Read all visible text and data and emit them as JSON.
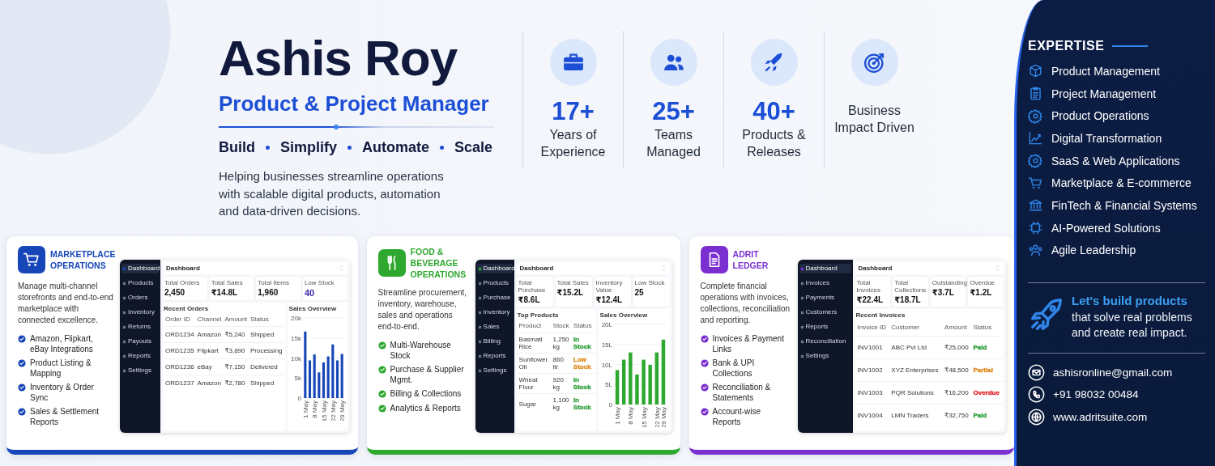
{
  "profile": {
    "name": "Ashis Roy",
    "role": "Product & Project Manager",
    "pillars": [
      "Build",
      "Simplify",
      "Automate",
      "Scale"
    ],
    "summary": "Helping businesses streamline operations with scalable digital products, automation and data-driven decisions."
  },
  "highlights": [
    {
      "value": "17+",
      "label": "Years of Experience"
    },
    {
      "value": "25+",
      "label": "Teams Managed"
    },
    {
      "value": "40+",
      "label": "Products & Releases"
    },
    {
      "label": "Business Impact Driven"
    }
  ],
  "cards": [
    {
      "title": "MARKETPLACE OPERATIONS",
      "color": "#1746b8",
      "description": "Manage multi-channel storefronts and end-to-end marketplace with connected excellence.",
      "features": [
        "Amazon, Flipkart, eBay Integrations",
        "Product Listing & Mapping",
        "Inventory & Order Sync",
        "Sales & Settlement Reports"
      ],
      "dashboard": {
        "nav": [
          {
            "label": "Dashboard",
            "selected": true
          },
          {
            "label": "Products",
            "selected": false
          },
          {
            "label": "Orders",
            "selected": false
          },
          {
            "label": "Inventory",
            "selected": false
          },
          {
            "label": "Returns",
            "selected": false
          },
          {
            "label": "Payouts",
            "selected": false
          },
          {
            "label": "Reports",
            "selected": false
          },
          {
            "label": "Settings",
            "selected": false
          }
        ],
        "heading": "Dashboard",
        "stats": [
          {
            "label": "Total Orders",
            "value": "2,450",
            "highlighted": false
          },
          {
            "label": "Total Sales",
            "value": "₹14.8L",
            "highlighted": false
          },
          {
            "label": "Total Items",
            "value": "1,960",
            "highlighted": false
          },
          {
            "label": "Low Stock",
            "value": "40",
            "highlighted": true
          }
        ],
        "table": {
          "title": "Recent Orders",
          "columns": [
            "Order ID",
            "Channel",
            "Amount",
            "Status"
          ],
          "rows": [
            {
              "cells": [
                "ORD1234",
                "Amazon",
                "₹5,240",
                "Shipped"
              ]
            },
            {
              "cells": [
                "ORD1235",
                "Flipkart",
                "₹3,890",
                "Processing"
              ]
            },
            {
              "cells": [
                "ORD1236",
                "eBay",
                "₹7,150",
                "Delivered"
              ]
            },
            {
              "cells": [
                "ORD1237",
                "Amazon",
                "₹2,780",
                "Shipped"
              ]
            }
          ]
        },
        "chart": {
          "title": "Sales Overview",
          "chart_data": {
            "type": "bar",
            "categories": [
              "1 May",
              null,
              "8 May",
              null,
              "15 May",
              null,
              "22 May",
              null,
              "29 May"
            ],
            "values": [
              16.6,
              9.4,
              10.9,
              6.4,
              8.9,
              10.4,
              13.4,
              9.4,
              11
            ],
            "grid": true,
            "ylim": [
              0,
              20
            ],
            "yticks": [
              {
                "value": 0,
                "label": "0"
              },
              {
                "value": 5,
                "label": "5k"
              },
              {
                "value": 10,
                "label": "10k"
              },
              {
                "value": 15,
                "label": "15k"
              },
              {
                "value": 20,
                "label": "20k"
              }
            ]
          }
        }
      }
    },
    {
      "title": "FOOD & BEVERAGE OPERATIONS",
      "color": "#2ea82e",
      "description": "Streamline procurement, inventory, warehouse, sales and operations end-to-end.",
      "features": [
        "Multi-Warehouse Stock",
        "Purchase & Supplier Mgmt.",
        "Billing & Collections",
        "Analytics & Reports"
      ],
      "dashboard": {
        "nav": [
          {
            "label": "Dashboard",
            "selected": true
          },
          {
            "label": "Products",
            "selected": false
          },
          {
            "label": "Purchase",
            "selected": false
          },
          {
            "label": "Inventory",
            "selected": false
          },
          {
            "label": "Sales",
            "selected": false
          },
          {
            "label": "Billing",
            "selected": false
          },
          {
            "label": "Reports",
            "selected": false
          },
          {
            "label": "Settings",
            "selected": false
          }
        ],
        "heading": "Dashboard",
        "stats": [
          {
            "label": "Total Purchase",
            "value": "₹8.6L"
          },
          {
            "label": "Total Sales",
            "value": "₹15.2L"
          },
          {
            "label": "Inventory Value",
            "value": "₹12.4L"
          },
          {
            "label": "Low Stock",
            "value": "25"
          }
        ],
        "table": {
          "title": "Top Products",
          "columns": [
            "Product",
            "Stock",
            "Status"
          ],
          "rows": [
            {
              "cells": [
                "Basmati Rice",
                "1,250 kg",
                "In Stock"
              ],
              "color": "#2e9e3a"
            },
            {
              "cells": [
                "Sunflower Oil",
                "860 ltr",
                "Low Stock"
              ],
              "color": "#e08a1e"
            },
            {
              "cells": [
                "Wheat Flour",
                "920 kg",
                "In Stock"
              ],
              "color": "#2e9e3a"
            },
            {
              "cells": [
                "Sugar",
                "1,100 kg",
                "In Stock"
              ],
              "color": "#2e9e3a"
            }
          ]
        },
        "chart": {
          "title": "Sales Overview",
          "chart_data": {
            "type": "bar",
            "categories": [
              "1 May",
              null,
              "8 May",
              null,
              "15 May",
              null,
              "22 May",
              "29 May"
            ],
            "values": [
              8.6,
              11.2,
              13,
              7.5,
              11.2,
              9.9,
              13,
              16.2
            ],
            "grid": true,
            "ylim": [
              0,
              20
            ],
            "yticks": [
              {
                "value": 0,
                "label": "0"
              },
              {
                "value": 5,
                "label": "5L"
              },
              {
                "value": 10,
                "label": "10L"
              },
              {
                "value": 15,
                "label": "15L"
              },
              {
                "value": 20,
                "label": "20L"
              }
            ]
          }
        }
      }
    },
    {
      "title": "ADRIT LEDGER",
      "color": "#7a2fd0",
      "description": "Complete financial operations with invoices, collections, reconciliation and reporting.",
      "features": [
        "Invoices & Payment Links",
        "Bank & UPI Collections",
        "Reconciliation & Statements",
        "Account-wise Reports"
      ],
      "dashboard": {
        "nav": [
          {
            "label": "Dashboard",
            "selected": true
          },
          {
            "label": "Invoices",
            "selected": false
          },
          {
            "label": "Payments",
            "selected": false
          },
          {
            "label": "Customers",
            "selected": false
          },
          {
            "label": "Reports",
            "selected": false
          },
          {
            "label": "Reconciliation",
            "selected": false
          },
          {
            "label": "Settings",
            "selected": false
          }
        ],
        "heading": "Dashboard",
        "stats": [
          {
            "label": "Total Invoices",
            "value": "₹22.4L"
          },
          {
            "label": "Total Collections",
            "value": "₹18.7L"
          },
          {
            "label": "Outstanding",
            "value": "₹3.7L"
          },
          {
            "label": "Overdue",
            "value": "₹1.2L"
          }
        ],
        "table": {
          "title": "Recent Invoices",
          "columns": [
            "Invoice ID",
            "Customer",
            "Amount",
            "Status"
          ],
          "rows": [
            {
              "cells": [
                "INV1001",
                "ABC Pvt Ltd",
                "₹25,000",
                "Paid"
              ],
              "color": "#2e9e3a"
            },
            {
              "cells": [
                "INV1002",
                "XYZ Enterprises",
                "₹48,500",
                "Partial"
              ],
              "color": "#e08a1e"
            },
            {
              "cells": [
                "INV1003",
                "PQR Solutions",
                "₹16,200",
                "Overdue"
              ],
              "color": "#e0262b"
            },
            {
              "cells": [
                "INV1004",
                "LMN Traders",
                "₹32,750",
                "Paid"
              ],
              "color": "#2e9e3a"
            }
          ]
        }
      }
    }
  ],
  "sidebar": {
    "heading": "EXPERTISE",
    "items": [
      "Product Management",
      "Project Management",
      "Product Operations",
      "Digital Transformation",
      "SaaS & Web Applications",
      "Marketplace & E-commerce",
      "FinTech & Financial Systems",
      "AI-Powered Solutions",
      "Agile Leadership"
    ],
    "cta": {
      "highlight": "Let's build products",
      "text": "that solve real problems and create real impact."
    },
    "contacts": [
      {
        "kind": "email",
        "text": "ashisronline@gmail.com"
      },
      {
        "kind": "phone",
        "text": "+91 98032 00484"
      },
      {
        "kind": "website",
        "text": "www.adritsuite.com"
      }
    ]
  }
}
